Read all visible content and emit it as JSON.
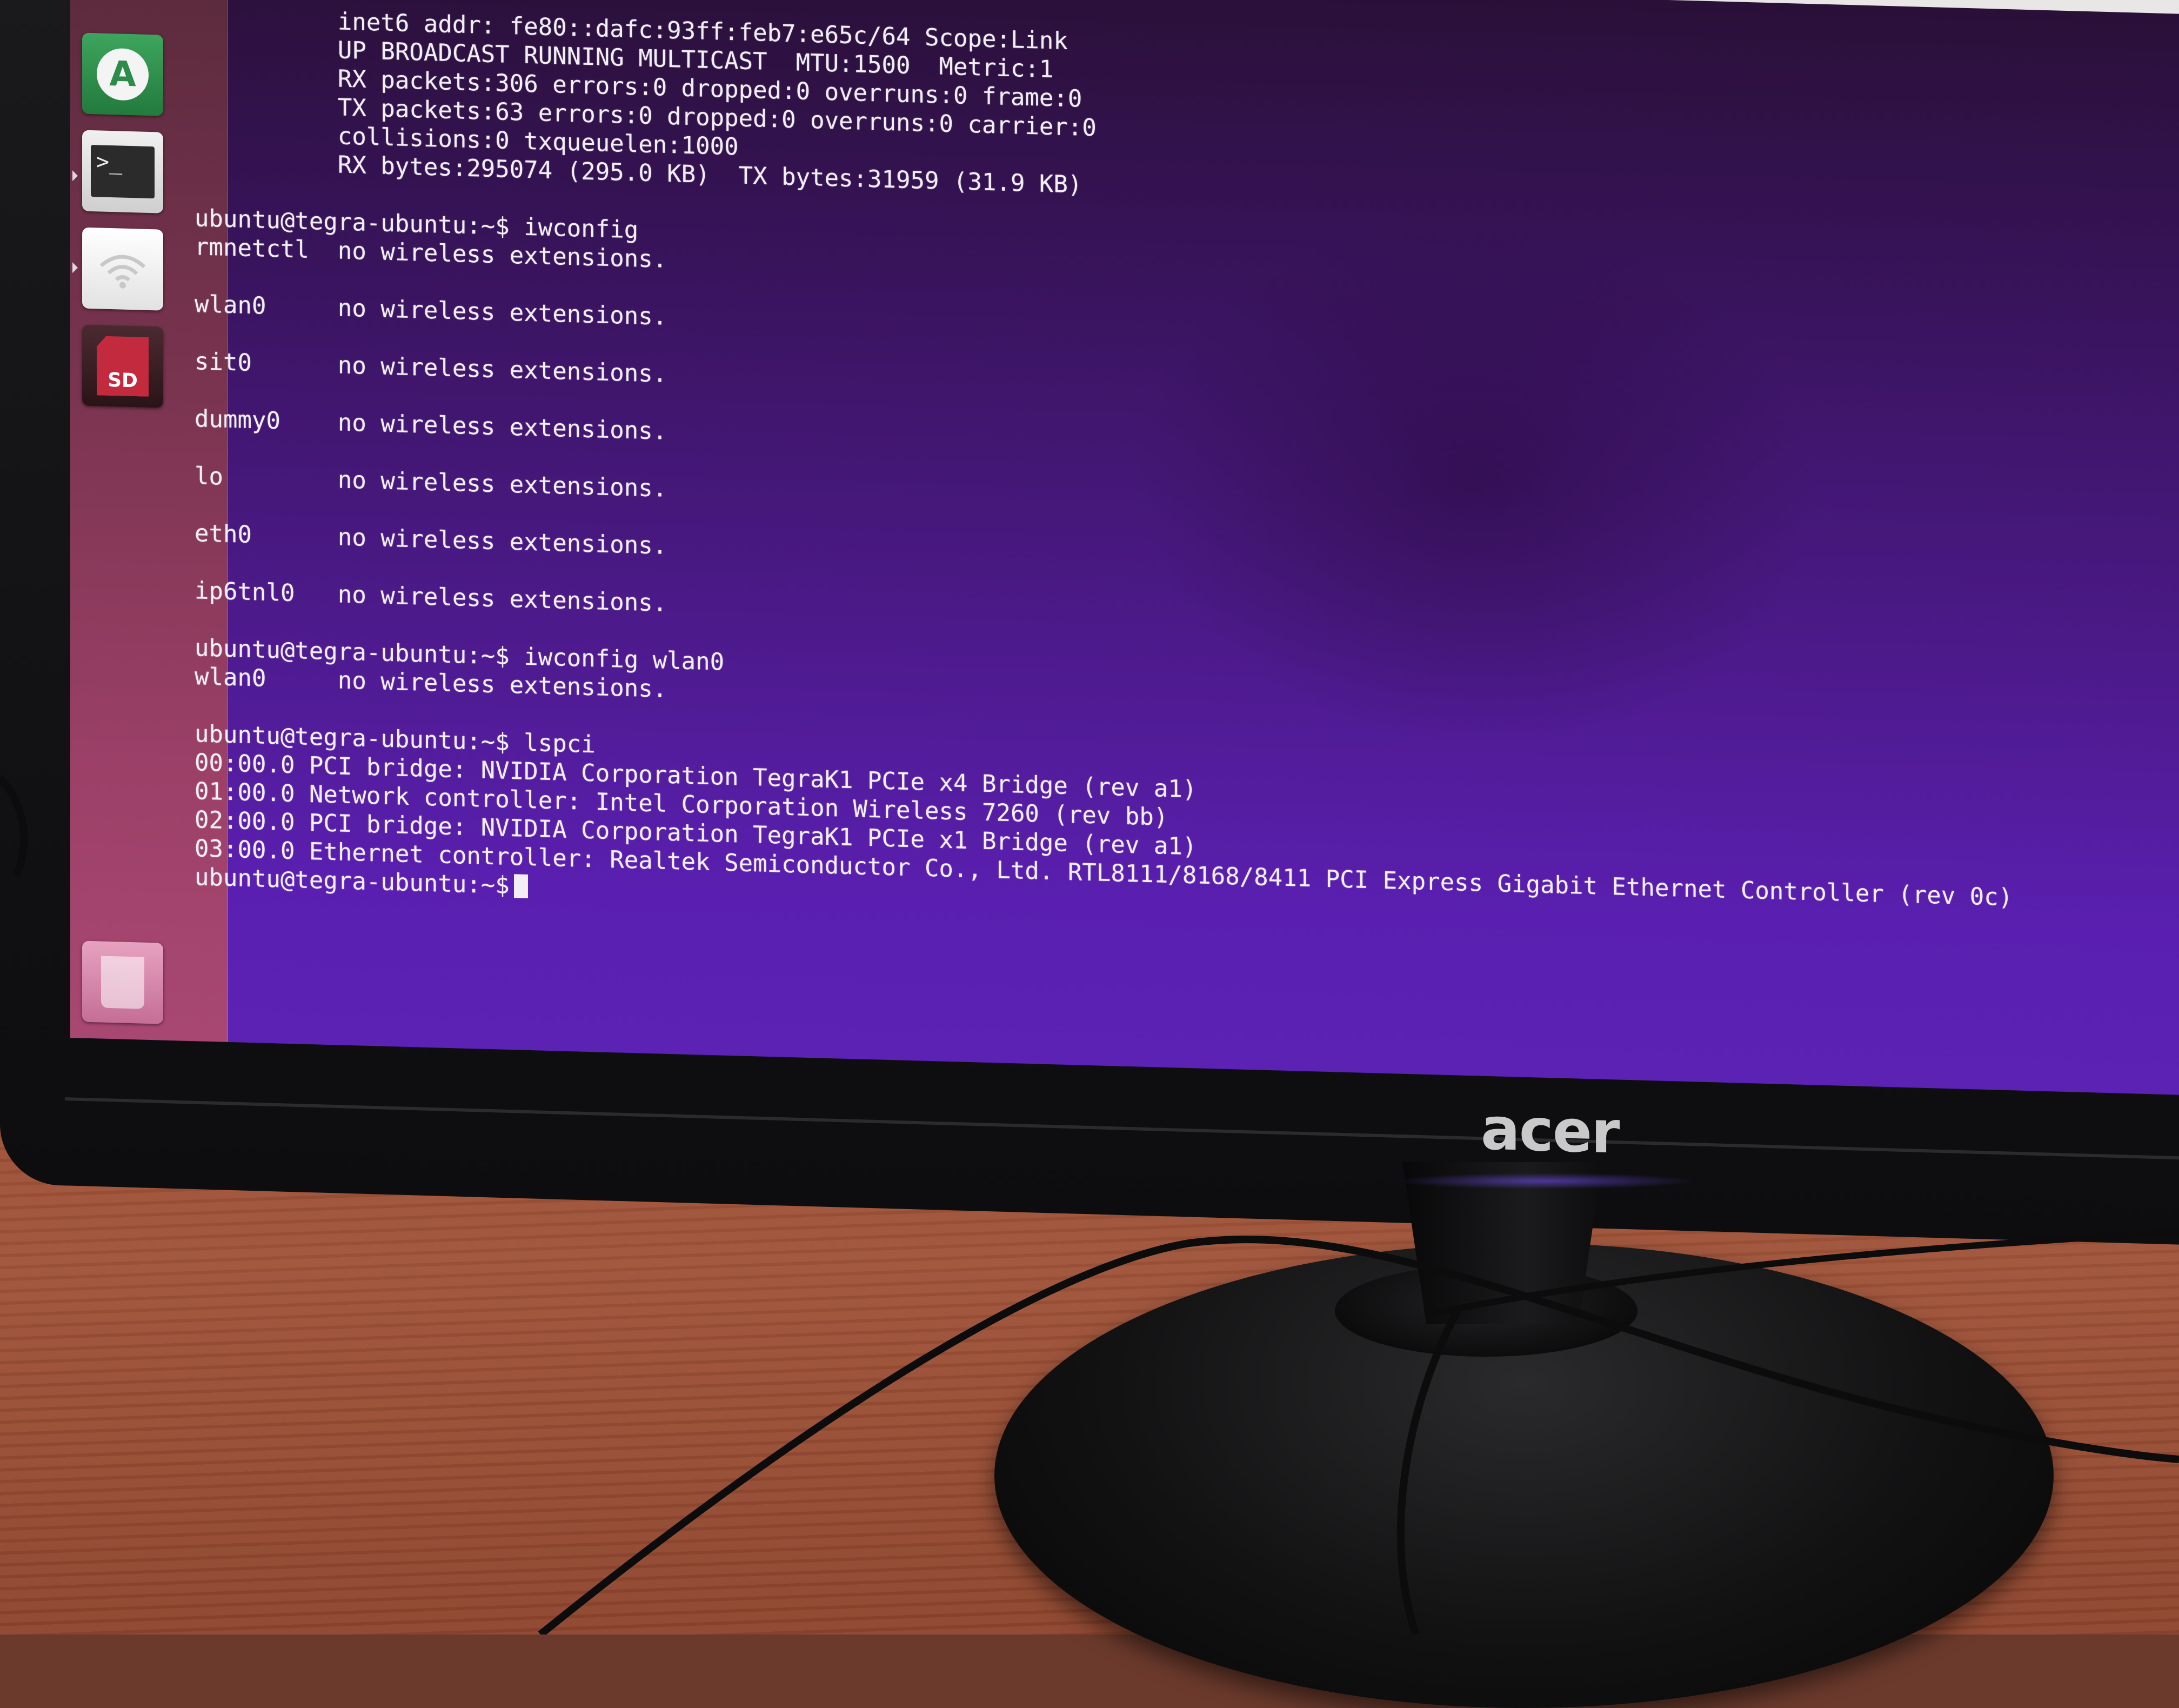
{
  "monitor": {
    "brand": "acer"
  },
  "launcher": {
    "items": [
      {
        "name": "software-center",
        "glyph": "A",
        "color": "#2e8c4a"
      },
      {
        "name": "terminal",
        "glyph": ">_",
        "color": "#2b2b2b"
      },
      {
        "name": "wifi",
        "glyph": "",
        "color": "#e8e8e8"
      },
      {
        "name": "sd-card",
        "glyph": "SD",
        "color": "#b8283a"
      },
      {
        "name": "trash",
        "glyph": "",
        "color": "#d98fb0"
      }
    ]
  },
  "terminal": {
    "lines": [
      "          inet6 addr: fe80::dafc:93ff:feb7:e65c/64 Scope:Link",
      "          UP BROADCAST RUNNING MULTICAST  MTU:1500  Metric:1",
      "          RX packets:306 errors:0 dropped:0 overruns:0 frame:0",
      "          TX packets:63 errors:0 dropped:0 overruns:0 carrier:0",
      "          collisions:0 txqueuelen:1000",
      "          RX bytes:295074 (295.0 KB)  TX bytes:31959 (31.9 KB)",
      "",
      "ubuntu@tegra-ubuntu:~$ iwconfig",
      "rmnetctl  no wireless extensions.",
      "",
      "wlan0     no wireless extensions.",
      "",
      "sit0      no wireless extensions.",
      "",
      "dummy0    no wireless extensions.",
      "",
      "lo        no wireless extensions.",
      "",
      "eth0      no wireless extensions.",
      "",
      "ip6tnl0   no wireless extensions.",
      "",
      "ubuntu@tegra-ubuntu:~$ iwconfig wlan0",
      "wlan0     no wireless extensions.",
      "",
      "ubuntu@tegra-ubuntu:~$ lspci",
      "00:00.0 PCI bridge: NVIDIA Corporation TegraK1 PCIe x4 Bridge (rev a1)",
      "01:00.0 Network controller: Intel Corporation Wireless 7260 (rev bb)",
      "02:00.0 PCI bridge: NVIDIA Corporation TegraK1 PCIe x1 Bridge (rev a1)",
      "03:00.0 Ethernet controller: Realtek Semiconductor Co., Ltd. RTL8111/8168/8411 PCI Express Gigabit Ethernet Controller (rev 0c)"
    ],
    "prompt": "ubuntu@tegra-ubuntu:~$"
  }
}
